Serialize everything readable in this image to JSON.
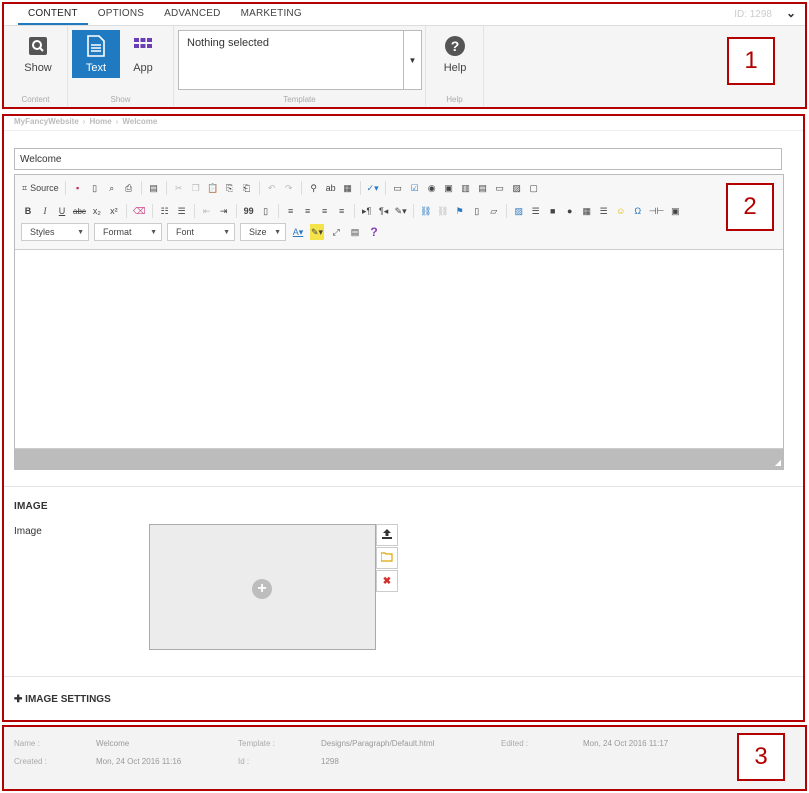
{
  "tabs": {
    "items": [
      {
        "label": "CONTENT",
        "active": true
      },
      {
        "label": "OPTIONS",
        "active": false
      },
      {
        "label": "ADVANCED",
        "active": false
      },
      {
        "label": "MARKETING",
        "active": false
      }
    ],
    "id_label": "ID: 1298",
    "chevron_icon": "chevron-down-icon"
  },
  "ribbon": {
    "content": {
      "show_label": "Show",
      "group_label": "Content",
      "icon": "search-icon"
    },
    "show": {
      "text_label": "Text",
      "app_label": "App",
      "group_label": "Show",
      "text_icon": "document-icon",
      "app_icon": "grid-icon"
    },
    "template": {
      "value": "Nothing selected",
      "group_label": "Template"
    },
    "help": {
      "label": "Help",
      "group_label": "Help",
      "icon": "question-icon"
    },
    "accent_color": "#1f7ac2"
  },
  "breadcrumb": [
    "MyFancyWebsite",
    "Home",
    "Welcome"
  ],
  "title_value": "Welcome",
  "editor": {
    "source_label": "Source",
    "combos": {
      "styles": "Styles",
      "format": "Format",
      "font": "Font",
      "size": "Size"
    },
    "bold": "B",
    "italic": "I",
    "underline": "U",
    "strike": "abc",
    "subscript": "x₂",
    "superscript": "x²",
    "blockquote": "99",
    "omega": "Ω",
    "help": "?"
  },
  "image_section": {
    "heading": "IMAGE",
    "field_label": "Image",
    "upload_icon": "upload-icon",
    "browse_icon": "folder-icon",
    "remove_icon": "close-icon"
  },
  "image_settings": {
    "label": "IMAGE SETTINGS",
    "icon": "plus-icon"
  },
  "footer": {
    "name_label": "Name :",
    "name_value": "Welcome",
    "created_label": "Created :",
    "created_value": "Mon, 24 Oct 2016 11:16",
    "template_label": "Template :",
    "template_value": "Designs/Paragraph/Default.html",
    "id_label": "Id :",
    "id_value": "1298",
    "edited_label": "Edited :",
    "edited_value": "Mon, 24 Oct 2016 11:17"
  },
  "annotations": [
    "1",
    "2",
    "3"
  ],
  "annotation_color": "#b30000"
}
